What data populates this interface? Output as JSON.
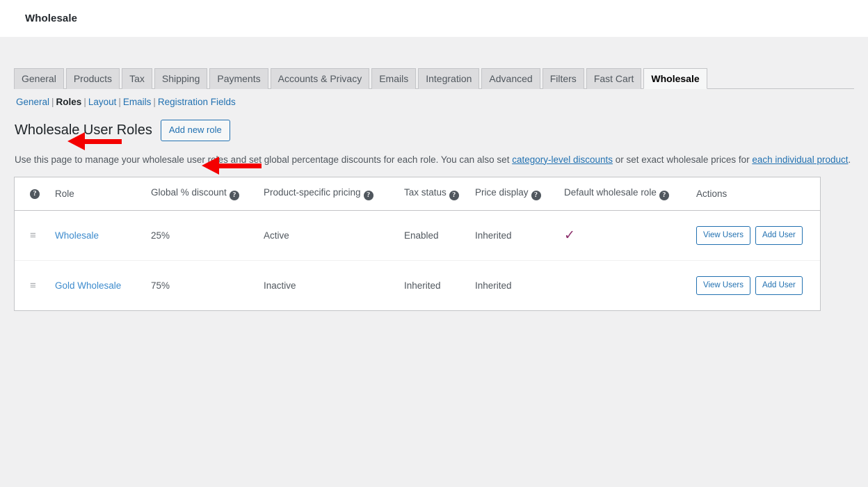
{
  "adminbar": {
    "title": "Wholesale"
  },
  "tabs": [
    {
      "label": "General",
      "active": false
    },
    {
      "label": "Products",
      "active": false
    },
    {
      "label": "Tax",
      "active": false
    },
    {
      "label": "Shipping",
      "active": false
    },
    {
      "label": "Payments",
      "active": false
    },
    {
      "label": "Accounts & Privacy",
      "active": false
    },
    {
      "label": "Emails",
      "active": false
    },
    {
      "label": "Integration",
      "active": false
    },
    {
      "label": "Advanced",
      "active": false
    },
    {
      "label": "Filters",
      "active": false
    },
    {
      "label": "Fast Cart",
      "active": false
    },
    {
      "label": "Wholesale",
      "active": true
    }
  ],
  "subnav": {
    "items": [
      {
        "label": "General",
        "current": false
      },
      {
        "label": "Roles",
        "current": true
      },
      {
        "label": "Layout",
        "current": false
      },
      {
        "label": "Emails",
        "current": false
      },
      {
        "label": "Registration Fields",
        "current": false
      }
    ],
    "separator": "|"
  },
  "header": {
    "title": "Wholesale User Roles",
    "add_role_label": "Add new role"
  },
  "description": {
    "part1": "Use this page to manage your wholesale user roles and set global percentage discounts for each role. You can also set ",
    "link1": "category-level discounts",
    "part2": " or set exact wholesale prices for ",
    "link2": "each individual product",
    "part3": "."
  },
  "table": {
    "columns": [
      {
        "label": "",
        "help": true
      },
      {
        "label": "Role",
        "help": false
      },
      {
        "label": "Global % discount",
        "help": true
      },
      {
        "label": "Product-specific pricing",
        "help": true
      },
      {
        "label": "Tax status",
        "help": true
      },
      {
        "label": "Price display",
        "help": true
      },
      {
        "label": "Default wholesale role",
        "help": true
      },
      {
        "label": "Actions",
        "help": false
      }
    ],
    "help_glyph": "?",
    "handle_glyph": "≡",
    "check_glyph": "✓",
    "rows": [
      {
        "role": "Wholesale",
        "discount": "25%",
        "product_specific_pricing": "Active",
        "tax_status": "Enabled",
        "price_display": "Inherited",
        "is_default": true,
        "view_users_label": "View Users",
        "add_user_label": "Add User"
      },
      {
        "role": "Gold Wholesale",
        "discount": "75%",
        "product_specific_pricing": "Inactive",
        "tax_status": "Inherited",
        "price_display": "Inherited",
        "is_default": false,
        "view_users_label": "View Users",
        "add_user_label": "Add User"
      }
    ]
  },
  "annotations": {
    "arrow_color": "#f40000",
    "arrows": [
      {
        "name": "arrow-pointing-to-roles-link"
      },
      {
        "name": "arrow-pointing-to-add-new-role-button"
      }
    ]
  }
}
